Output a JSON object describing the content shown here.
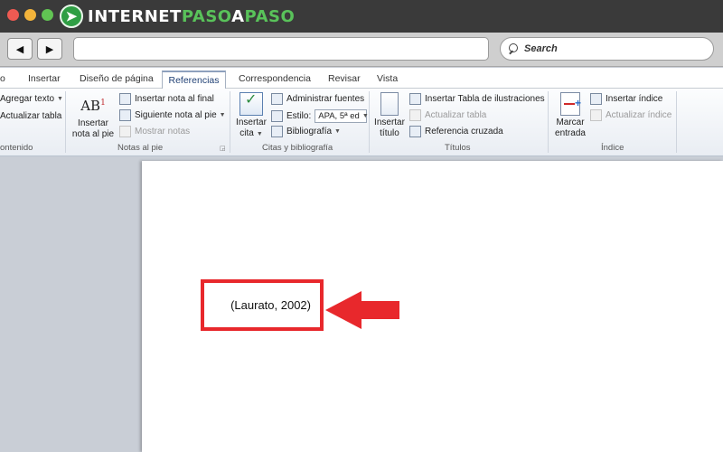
{
  "logo": {
    "part1": "INTERNET",
    "part2": "PASO",
    "part3": "A",
    "part4": "PASO"
  },
  "browser": {
    "search_placeholder": "Search",
    "back_glyph": "◀",
    "forward_glyph": "▶"
  },
  "tabs": [
    "o",
    "Insertar",
    "Diseño de página",
    "Referencias",
    "Correspondencia",
    "Revisar",
    "Vista"
  ],
  "active_tab": "Referencias",
  "ribbon": {
    "contenido": {
      "agregar_texto": "Agregar texto",
      "actualizar_tabla": "Actualizar tabla",
      "label": "ontenido"
    },
    "notas": {
      "insertar_nota_pie_1": "Insertar",
      "insertar_nota_pie_2": "nota al pie",
      "insertar_nota_final": "Insertar nota al final",
      "siguiente_nota": "Siguiente nota al pie",
      "mostrar_notas": "Mostrar notas",
      "label": "Notas al pie",
      "ab_glyph": "AB",
      "superscript": "1"
    },
    "citas": {
      "insertar_cita_1": "Insertar",
      "insertar_cita_2": "cita",
      "administrar_fuentes": "Administrar fuentes",
      "estilo_label": "Estilo:",
      "estilo_value": "APA, 5ª ed",
      "bibliografia": "Bibliografía",
      "label": "Citas y bibliografía"
    },
    "titulos": {
      "insertar_titulo_1": "Insertar",
      "insertar_titulo_2": "título",
      "insertar_tabla_ilustraciones": "Insertar Tabla de ilustraciones",
      "actualizar_tabla": "Actualizar tabla",
      "referencia_cruzada": "Referencia cruzada",
      "label": "Títulos"
    },
    "indice": {
      "marcar_entrada_1": "Marcar",
      "marcar_entrada_2": "entrada",
      "insertar_indice": "Insertar índice",
      "actualizar_indice": "Actualizar índice",
      "label": "Índice"
    }
  },
  "document": {
    "citation": "(Laurato, 2002)"
  },
  "colors": {
    "highlight_red": "#e8282c",
    "logo_green": "#59c25a"
  }
}
